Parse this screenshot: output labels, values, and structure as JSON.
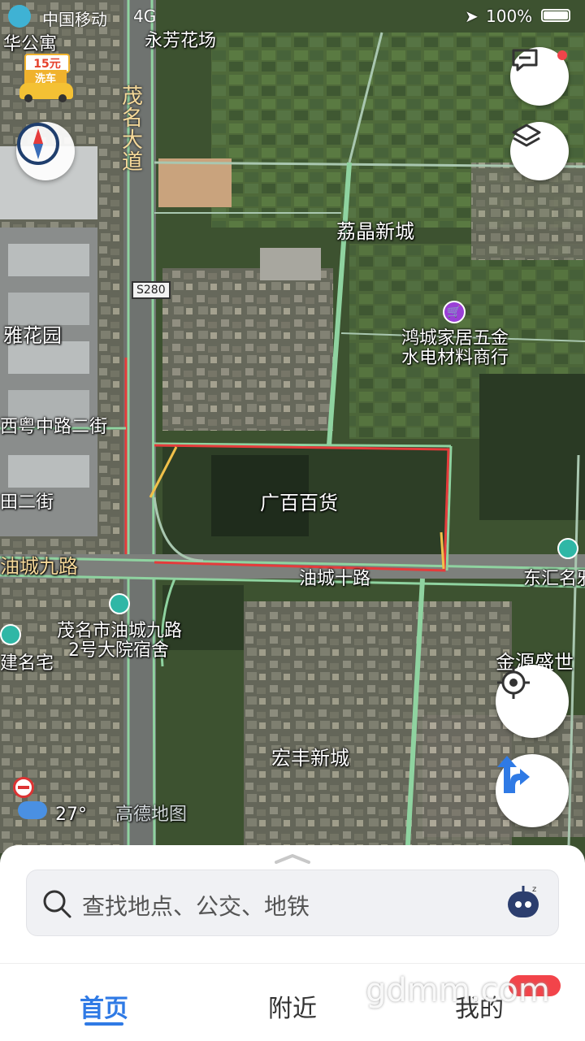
{
  "status_bar": {
    "carrier": "中国移动",
    "network": "4G",
    "battery": "100%"
  },
  "map": {
    "scale_text": "27°",
    "provider": "高德地图",
    "road_shield": "S280",
    "car_wash_badge": {
      "price": "15元",
      "label": "洗车"
    },
    "labels": {
      "huagongyu": "华公寓",
      "yongfang": "永芳花场",
      "maoming_avenue": "茂名大道",
      "lijing": "荔晶新城",
      "honcheng": "鸿城家居五金",
      "honcheng2": "水电材料商行",
      "yahuayuan": "雅花园",
      "xiyue": "西粤中路二街",
      "guangbai": "广百百货",
      "tianerjie": "田二街",
      "youcheng9": "油城九路",
      "youcheng10": "油城十路",
      "donghui": "东汇名邪",
      "dayuan1": "茂名市油城九路",
      "dayuan2": "2号大院宿舍",
      "jianming": "建名宅",
      "jinyuan": "金源盛世",
      "hongfeng": "宏丰新城"
    }
  },
  "search": {
    "placeholder": "查找地点、公交、地铁"
  },
  "tabs": {
    "home": "首页",
    "nearby": "附近",
    "mine": "我的"
  },
  "watermark": "gdmm.com",
  "colors": {
    "accent": "#2f7ae5",
    "road_green": "#8fd3a0",
    "boundary_red": "#e53b3b"
  }
}
